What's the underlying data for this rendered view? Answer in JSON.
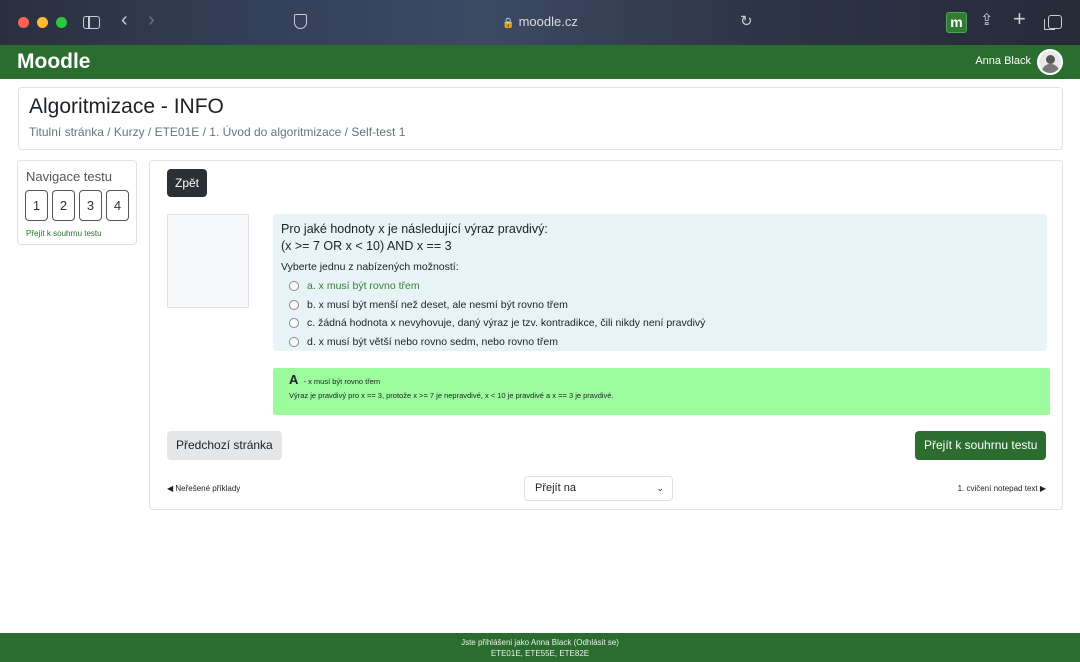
{
  "browser": {
    "url": "moodle.cz",
    "extension_label": "m"
  },
  "navbar": {
    "brand": "Moodle",
    "user_name": "Anna Black"
  },
  "header": {
    "title": "Algoritmizace - INFO",
    "breadcrumb": "Titulní stránka / Kurzy  / ETE01E /  1. Úvod do algoritmizace  / Self-test 1"
  },
  "quiz_nav": {
    "title": "Navigace testu",
    "buttons": [
      "1",
      "2",
      "3",
      "4"
    ],
    "finish_link": "Přejít k souhrnu testu"
  },
  "main": {
    "back_label": "Zpět",
    "question": {
      "line1": "Pro jaké hodnoty x je následující výraz pravdivý:",
      "line2": "(x >= 7 OR x < 10) AND x == 3",
      "prompt": "Vyberte jednu z nabízených možností:",
      "answers": [
        "a. x musí být rovno třem",
        "b. x musí být menší než deset, ale nesmí být rovno třem",
        "c. žádná hodnota x nevyhovuje, daný výraz je tzv. kontradikce, čili nikdy není pravdivý",
        "d. x musí být větší nebo rovno sedm, nebo rovno třem"
      ]
    },
    "feedback": {
      "letter": "A",
      "summary": "- x musí být rovno třem",
      "explanation": "Výraz je pravdivý pro x == 3, protože x >= 7 je nepravdivé, x < 10 je pravdivé a x == 3 je pravdivé."
    },
    "prev_page_label": "Předchozí stránka",
    "finish_label": "Přejít k souhrnu testu",
    "prev_activity": "◀ Neřešené příklady",
    "jump_label": "Přejít na",
    "next_activity": "1. cvičení notepad text ▶"
  },
  "footer": {
    "line1": "Jste přihlášeni jako Anna Black (Odhlásit se)",
    "line2": "ETE01E, ETE55E, ETE82E"
  }
}
